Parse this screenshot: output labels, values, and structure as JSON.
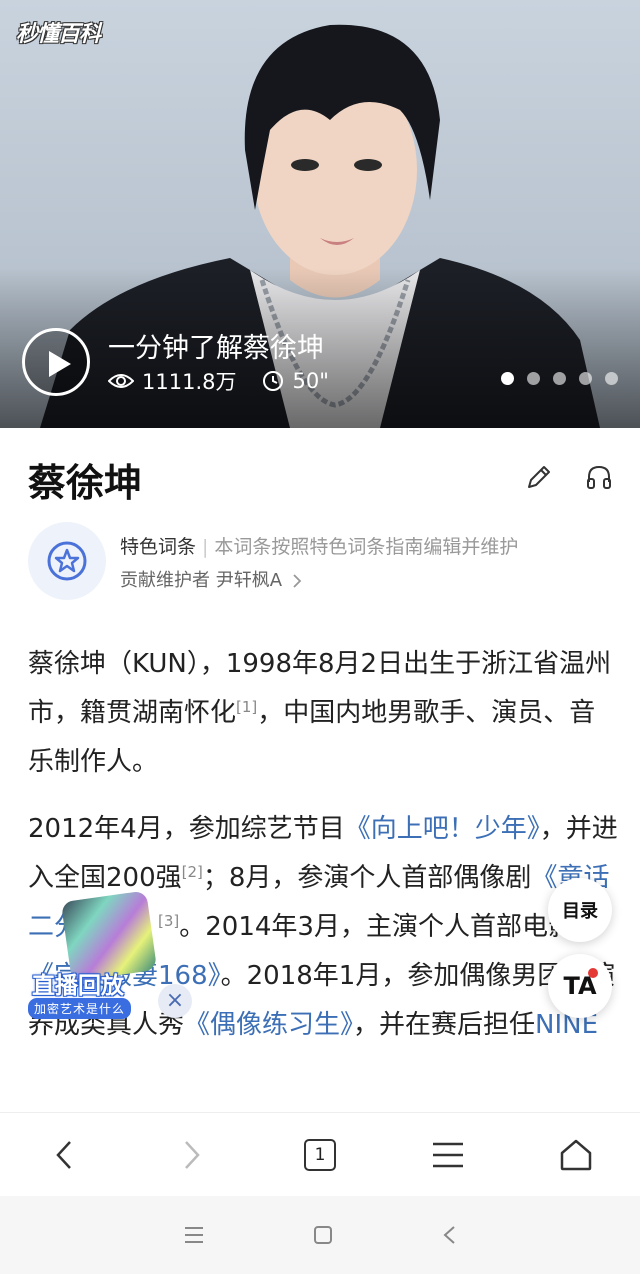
{
  "hero": {
    "logo": "秒懂百科",
    "video_title": "一分钟了解蔡徐坤",
    "views": "1111.8万",
    "duration": "50\"",
    "carousel_total": 5,
    "carousel_active": 1
  },
  "entry": {
    "title": "蔡徐坤",
    "edit_icon": "pencil-icon",
    "listen_icon": "headphones-icon"
  },
  "feature": {
    "tag": "特色词条",
    "separator": "|",
    "description": "本词条按照特色词条指南编辑并维护",
    "maintainer_label": "贡献维护者",
    "maintainer_name": "尹轩枫A"
  },
  "content": {
    "p1_a": "蔡徐坤（KUN），1998年8月2日出生于浙江省温州市，籍贯湖南怀化",
    "p1_ref": "[1]",
    "p1_b": "，中国内地男歌手、演员、音乐制作人。",
    "p2_a": "2012年4月，参加综艺节目",
    "p2_link1": "《向上吧！少年》",
    "p2_b": "，并进入全国200强",
    "p2_ref2": "[2]",
    "p2_c": "；8月，参演个人首部偶像剧",
    "p2_link2": "《童话二分之一》",
    "p2_ref3": "[3]",
    "p2_d": "。2014年3月，主演个人首部电影",
    "p2_link3": "《完美假妻168》",
    "p2_e": "。2018年1月，参加偶像男团竞演养成类真人秀",
    "p2_link4": "《偶像练习生》",
    "p2_f": "，并在赛后担任",
    "p2_link5": "NINE"
  },
  "floating": {
    "toc_label": "目录",
    "ta_label": "TA",
    "live_title": "直播回放",
    "live_sub": "加密艺术是什么",
    "live_close": "×"
  },
  "toolbar": {
    "tab_count": "1"
  }
}
